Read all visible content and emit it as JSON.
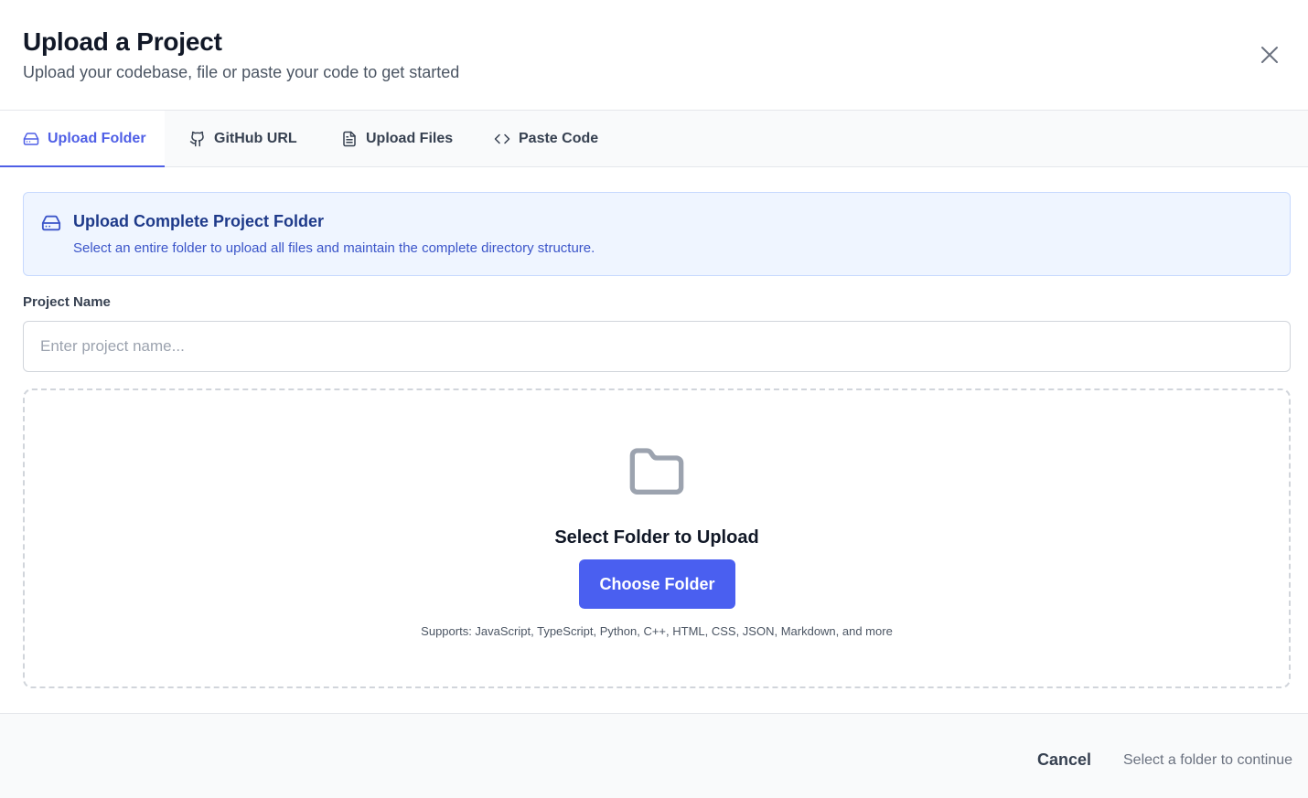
{
  "header": {
    "title": "Upload a Project",
    "subtitle": "Upload your codebase, file or paste your code to get started",
    "close_icon": "close-icon"
  },
  "tabs": [
    {
      "label": "Upload Folder",
      "icon": "hard-drive-icon",
      "active": true
    },
    {
      "label": "GitHub URL",
      "icon": "github-icon",
      "active": false
    },
    {
      "label": "Upload Files",
      "icon": "file-text-icon",
      "active": false
    },
    {
      "label": "Paste Code",
      "icon": "code-icon",
      "active": false
    }
  ],
  "info": {
    "icon": "hard-drive-icon",
    "title": "Upload Complete Project Folder",
    "description": "Select an entire folder to upload all files and maintain the complete directory structure."
  },
  "project_name": {
    "label": "Project Name",
    "value": "",
    "placeholder": "Enter project name..."
  },
  "dropzone": {
    "icon": "folder-icon",
    "title": "Select Folder to Upload",
    "button_label": "Choose Folder",
    "supports": "Supports: JavaScript, TypeScript, Python, C++, HTML, CSS, JSON, Markdown, and more"
  },
  "footer": {
    "cancel_label": "Cancel",
    "continue_hint": "Select a folder to continue"
  },
  "colors": {
    "accent": "#4f5fe6",
    "button_bg": "#4a5ff0",
    "info_bg": "#eff5ff",
    "info_title": "#1e3a8a"
  }
}
